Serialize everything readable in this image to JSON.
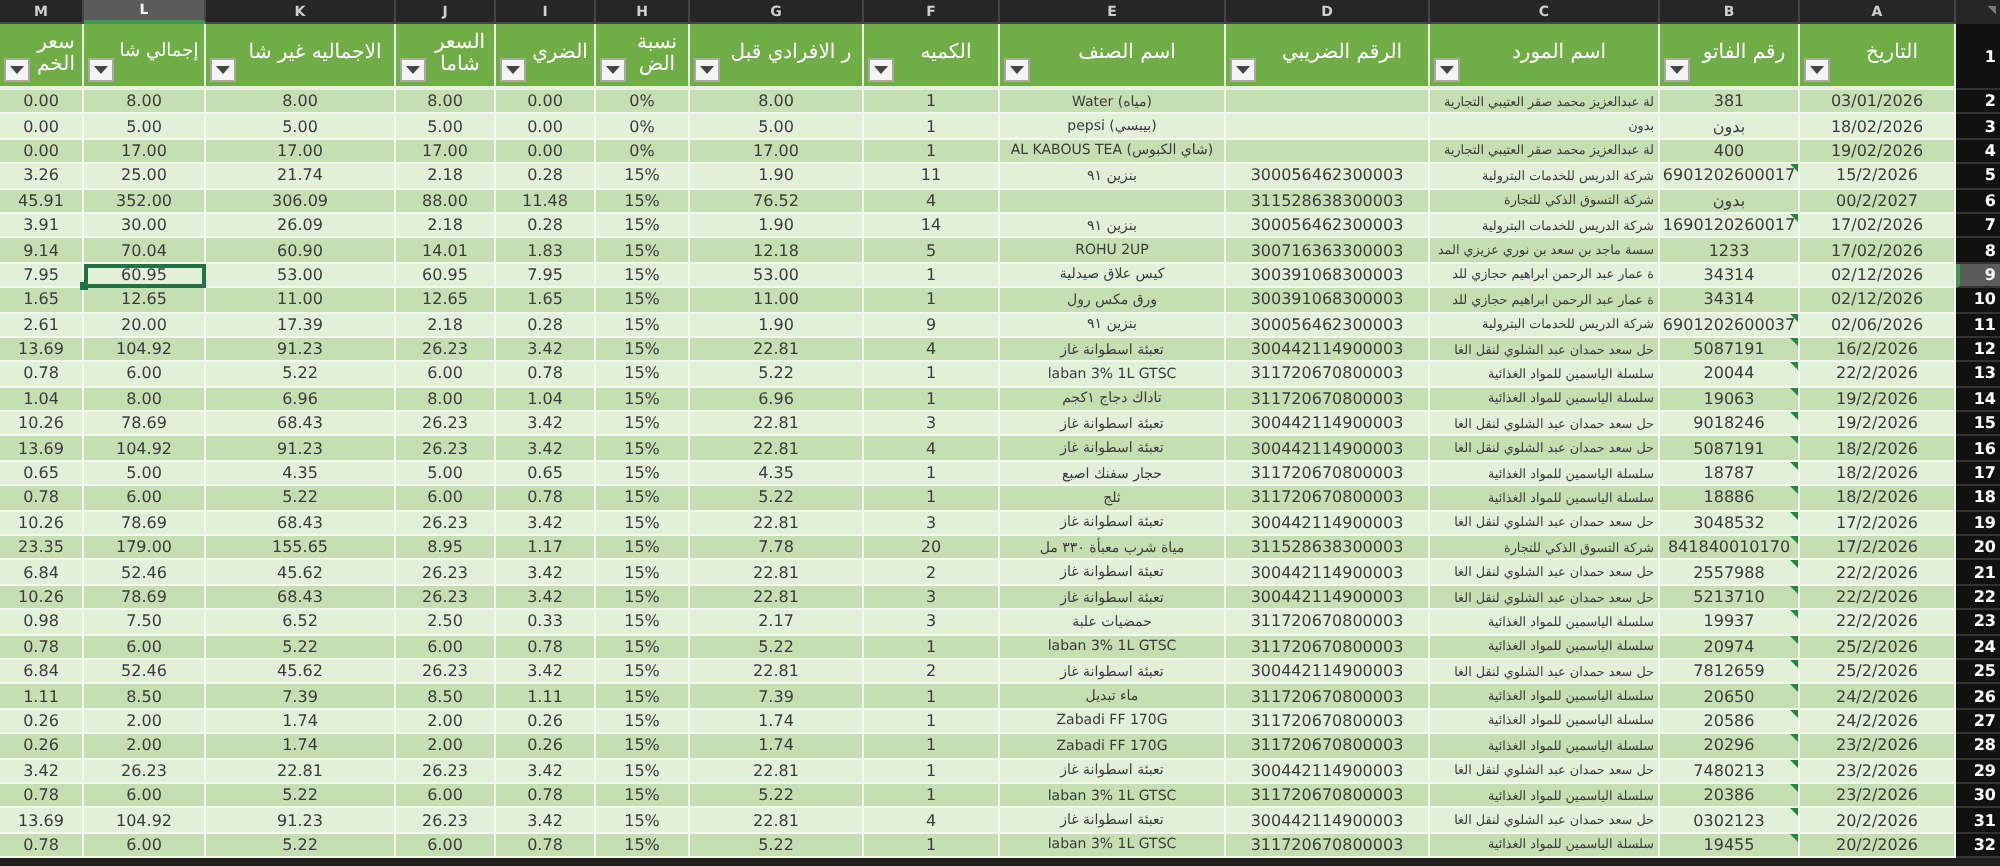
{
  "column_letters": [
    {
      "letter": "M",
      "selected": false
    },
    {
      "letter": "L",
      "selected": true
    },
    {
      "letter": "K",
      "selected": false
    },
    {
      "letter": "J",
      "selected": false
    },
    {
      "letter": "I",
      "selected": false
    },
    {
      "letter": "H",
      "selected": false
    },
    {
      "letter": "G",
      "selected": false
    },
    {
      "letter": "F",
      "selected": false
    },
    {
      "letter": "E",
      "selected": false
    },
    {
      "letter": "D",
      "selected": false
    },
    {
      "letter": "C",
      "selected": false
    },
    {
      "letter": "B",
      "selected": false
    },
    {
      "letter": "A",
      "selected": false
    }
  ],
  "header": {
    "row_number": "1",
    "cells": [
      "التاريخ",
      "رقم الفاتو",
      "اسم المورد",
      "الرقم الضريبي",
      "اسم الصنف",
      "الكميه",
      "ر الافرادي قبل",
      "نسبة الض",
      "الضري",
      "السعر شاما",
      "الاجماليه غير شا",
      "إجمالي شا",
      "سعر الخم"
    ]
  },
  "rows": [
    {
      "number": "2",
      "selected": false,
      "flagged": false,
      "cells": [
        "0.00",
        "8.00",
        "8.00",
        "8.00",
        "0.00",
        "0%",
        "8.00",
        "1",
        "Water (مياه)",
        null,
        "لة عبدالعزيز محمد صقر العتيبي التجارية",
        "381",
        "03/01/2026"
      ]
    },
    {
      "number": "3",
      "selected": false,
      "flagged": false,
      "cells": [
        "0.00",
        "5.00",
        "5.00",
        "5.00",
        "0.00",
        "0%",
        "5.00",
        "1",
        "pepsi (بيبسي)",
        null,
        "بدون",
        "بدون",
        "18/02/2026"
      ]
    },
    {
      "number": "4",
      "selected": false,
      "flagged": false,
      "cells": [
        "0.00",
        "17.00",
        "17.00",
        "17.00",
        "0.00",
        "0%",
        "17.00",
        "1",
        "AL KABOUS TEA (شاي الكبوس)",
        null,
        "لة عبدالعزيز محمد صقر العتيبي التجارية",
        "400",
        "19/02/2026"
      ]
    },
    {
      "number": "5",
      "selected": false,
      "flagged": true,
      "cells": [
        "3.26",
        "25.00",
        "21.74",
        "2.18",
        "0.28",
        "15%",
        "1.90",
        "11",
        "بنزين ٩١",
        "300056462300003",
        "شركة الدريس للخدمات البترولية",
        "6901202600017",
        "15/2/2026"
      ]
    },
    {
      "number": "6",
      "selected": false,
      "flagged": false,
      "cells": [
        "45.91",
        "352.00",
        "306.09",
        "88.00",
        "11.48",
        "15%",
        "76.52",
        "4",
        null,
        "311528638300003",
        "شركة التسوق الذكي للتجارة",
        "بدون",
        "00/2/2027"
      ]
    },
    {
      "number": "7",
      "selected": false,
      "flagged": true,
      "cells": [
        "3.91",
        "30.00",
        "26.09",
        "2.18",
        "0.28",
        "15%",
        "1.90",
        "14",
        "بنزين ٩١",
        "300056462300003",
        "شركة الدريس للخدمات البترولية",
        "1690120260017",
        "17/02/2026"
      ]
    },
    {
      "number": "8",
      "selected": false,
      "flagged": false,
      "cells": [
        "9.14",
        "70.04",
        "60.90",
        "14.01",
        "1.83",
        "15%",
        "12.18",
        "5",
        "ROHU 2UP",
        "300716363300003",
        "سسة ماجد بن سعد بن نوري عزيزي المد",
        "1233",
        "17/02/2026"
      ]
    },
    {
      "number": "9",
      "selected": true,
      "flagged": false,
      "cells": [
        "7.95",
        "60.95",
        "53.00",
        "60.95",
        "7.95",
        "15%",
        "53.00",
        "1",
        "كيس علاق صيدلية",
        "300391068300003",
        "ة عمار عبد الرحمن ابراهيم حجازي للد",
        "34314",
        "02/12/2026"
      ]
    },
    {
      "number": "10",
      "selected": false,
      "flagged": false,
      "cells": [
        "1.65",
        "12.65",
        "11.00",
        "12.65",
        "1.65",
        "15%",
        "11.00",
        "1",
        "ورق مكس رول",
        "300391068300003",
        "ة عمار عبد الرحمن ابراهيم حجازي للد",
        "34314",
        "02/12/2026"
      ]
    },
    {
      "number": "11",
      "selected": false,
      "flagged": true,
      "cells": [
        "2.61",
        "20.00",
        "17.39",
        "2.18",
        "0.28",
        "15%",
        "1.90",
        "9",
        "بنزين ٩١",
        "300056462300003",
        "شركة الدريس للخدمات البترولية",
        "6901202600037",
        "02/06/2026"
      ]
    },
    {
      "number": "12",
      "selected": false,
      "flagged": true,
      "cells": [
        "13.69",
        "104.92",
        "91.23",
        "26.23",
        "3.42",
        "15%",
        "22.81",
        "4",
        "تعبئة اسطوانة غاز",
        "300442114900003",
        "حل سعد حمدان عبد الشلوي لنقل الغا",
        "5087191",
        "16/2/2026"
      ]
    },
    {
      "number": "13",
      "selected": false,
      "flagged": true,
      "cells": [
        "0.78",
        "6.00",
        "5.22",
        "6.00",
        "0.78",
        "15%",
        "5.22",
        "1",
        "laban 3% 1L GTSC",
        "311720670800003",
        "سلسلة الياسمين للمواد الغذائية",
        "20044",
        "22/2/2026"
      ]
    },
    {
      "number": "14",
      "selected": false,
      "flagged": true,
      "cells": [
        "1.04",
        "8.00",
        "6.96",
        "8.00",
        "1.04",
        "15%",
        "6.96",
        "1",
        "تاداك دجاج ١كجم",
        "311720670800003",
        "سلسلة الياسمين للمواد الغذائية",
        "19063",
        "19/2/2026"
      ]
    },
    {
      "number": "15",
      "selected": false,
      "flagged": true,
      "cells": [
        "10.26",
        "78.69",
        "68.43",
        "26.23",
        "3.42",
        "15%",
        "22.81",
        "3",
        "تعبئة اسطوانة غاز",
        "300442114900003",
        "حل سعد حمدان عبد الشلوي لنقل الغا",
        "9018246",
        "19/2/2026"
      ]
    },
    {
      "number": "16",
      "selected": false,
      "flagged": true,
      "cells": [
        "13.69",
        "104.92",
        "91.23",
        "26.23",
        "3.42",
        "15%",
        "22.81",
        "4",
        "تعبئة اسطوانة غاز",
        "300442114900003",
        "حل سعد حمدان عبد الشلوي لنقل الغا",
        "5087191",
        "18/2/2026"
      ]
    },
    {
      "number": "17",
      "selected": false,
      "flagged": true,
      "cells": [
        "0.65",
        "5.00",
        "4.35",
        "5.00",
        "0.65",
        "15%",
        "4.35",
        "1",
        "حجار سفنك اصبع",
        "311720670800003",
        "سلسلة الياسمين للمواد الغذائية",
        "18787",
        "18/2/2026"
      ]
    },
    {
      "number": "18",
      "selected": false,
      "flagged": true,
      "cells": [
        "0.78",
        "6.00",
        "5.22",
        "6.00",
        "0.78",
        "15%",
        "5.22",
        "1",
        "ثلج",
        "311720670800003",
        "سلسلة الياسمين للمواد الغذائية",
        "18886",
        "18/2/2026"
      ]
    },
    {
      "number": "19",
      "selected": false,
      "flagged": true,
      "cells": [
        "10.26",
        "78.69",
        "68.43",
        "26.23",
        "3.42",
        "15%",
        "22.81",
        "3",
        "تعبئة اسطوانة غاز",
        "300442114900003",
        "حل سعد حمدان عبد الشلوي لنقل الغا",
        "3048532",
        "17/2/2026"
      ]
    },
    {
      "number": "20",
      "selected": false,
      "flagged": true,
      "cells": [
        "23.35",
        "179.00",
        "155.65",
        "8.95",
        "1.17",
        "15%",
        "7.78",
        "20",
        "مياة شرب معبأة ٣٣٠ مل",
        "311528638300003",
        "شركة التسوق الذكي للتجارة",
        "841840010170",
        "17/2/2026"
      ]
    },
    {
      "number": "21",
      "selected": false,
      "flagged": true,
      "cells": [
        "6.84",
        "52.46",
        "45.62",
        "26.23",
        "3.42",
        "15%",
        "22.81",
        "2",
        "تعبئة اسطوانة غاز",
        "300442114900003",
        "حل سعد حمدان عبد الشلوي لنقل الغا",
        "2557988",
        "22/2/2026"
      ]
    },
    {
      "number": "22",
      "selected": false,
      "flagged": true,
      "cells": [
        "10.26",
        "78.69",
        "68.43",
        "26.23",
        "3.42",
        "15%",
        "22.81",
        "3",
        "تعبئة اسطوانة غاز",
        "300442114900003",
        "حل سعد حمدان عبد الشلوي لنقل الغا",
        "5213710",
        "22/2/2026"
      ]
    },
    {
      "number": "23",
      "selected": false,
      "flagged": true,
      "cells": [
        "0.98",
        "7.50",
        "6.52",
        "2.50",
        "0.33",
        "15%",
        "2.17",
        "3",
        "حمضيات علبة",
        "311720670800003",
        "سلسلة الياسمين للمواد الغذائية",
        "19937",
        "22/2/2026"
      ]
    },
    {
      "number": "24",
      "selected": false,
      "flagged": true,
      "cells": [
        "0.78",
        "6.00",
        "5.22",
        "6.00",
        "0.78",
        "15%",
        "5.22",
        "1",
        "laban 3% 1L GTSC",
        "311720670800003",
        "سلسلة الياسمين للمواد الغذائية",
        "20974",
        "25/2/2026"
      ]
    },
    {
      "number": "25",
      "selected": false,
      "flagged": true,
      "cells": [
        "6.84",
        "52.46",
        "45.62",
        "26.23",
        "3.42",
        "15%",
        "22.81",
        "2",
        "تعبئة اسطوانة غاز",
        "300442114900003",
        "حل سعد حمدان عبد الشلوي لنقل الغا",
        "7812659",
        "25/2/2026"
      ]
    },
    {
      "number": "26",
      "selected": false,
      "flagged": true,
      "cells": [
        "1.11",
        "8.50",
        "7.39",
        "8.50",
        "1.11",
        "15%",
        "7.39",
        "1",
        "ماء تبديل",
        "311720670800003",
        "سلسلة الياسمين للمواد الغذائية",
        "20650",
        "24/2/2026"
      ]
    },
    {
      "number": "27",
      "selected": false,
      "flagged": true,
      "cells": [
        "0.26",
        "2.00",
        "1.74",
        "2.00",
        "0.26",
        "15%",
        "1.74",
        "1",
        "Zabadi FF 170G",
        "311720670800003",
        "سلسلة الياسمين للمواد الغذائية",
        "20586",
        "24/2/2026"
      ]
    },
    {
      "number": "28",
      "selected": false,
      "flagged": true,
      "cells": [
        "0.26",
        "2.00",
        "1.74",
        "2.00",
        "0.26",
        "15%",
        "1.74",
        "1",
        "Zabadi FF 170G",
        "311720670800003",
        "سلسلة الياسمين للمواد الغذائية",
        "20296",
        "23/2/2026"
      ]
    },
    {
      "number": "29",
      "selected": false,
      "flagged": true,
      "cells": [
        "3.42",
        "26.23",
        "22.81",
        "26.23",
        "3.42",
        "15%",
        "22.81",
        "1",
        "تعبئة اسطوانة غاز",
        "300442114900003",
        "حل سعد حمدان عبد الشلوي لنقل الغا",
        "7480213",
        "23/2/2026"
      ]
    },
    {
      "number": "30",
      "selected": false,
      "flagged": true,
      "cells": [
        "0.78",
        "6.00",
        "5.22",
        "6.00",
        "0.78",
        "15%",
        "5.22",
        "1",
        "laban 3% 1L GTSC",
        "311720670800003",
        "سلسلة الياسمين للمواد الغذائية",
        "20386",
        "23/2/2026"
      ]
    },
    {
      "number": "31",
      "selected": false,
      "flagged": true,
      "cells": [
        "13.69",
        "104.92",
        "91.23",
        "26.23",
        "3.42",
        "15%",
        "22.81",
        "4",
        "تعبئة اسطوانة غاز",
        "300442114900003",
        "حل سعد حمدان عبد الشلوي لنقل الغا",
        "0302123",
        "20/2/2026"
      ]
    },
    {
      "number": "32",
      "selected": false,
      "flagged": true,
      "cells": [
        "0.78",
        "6.00",
        "5.22",
        "6.00",
        "0.78",
        "15%",
        "5.22",
        "1",
        "laban 3% 1L GTSC",
        "311720670800003",
        "سلسلة الياسمين للمواد الغذائية",
        "19455",
        "20/2/2026"
      ]
    }
  ]
}
